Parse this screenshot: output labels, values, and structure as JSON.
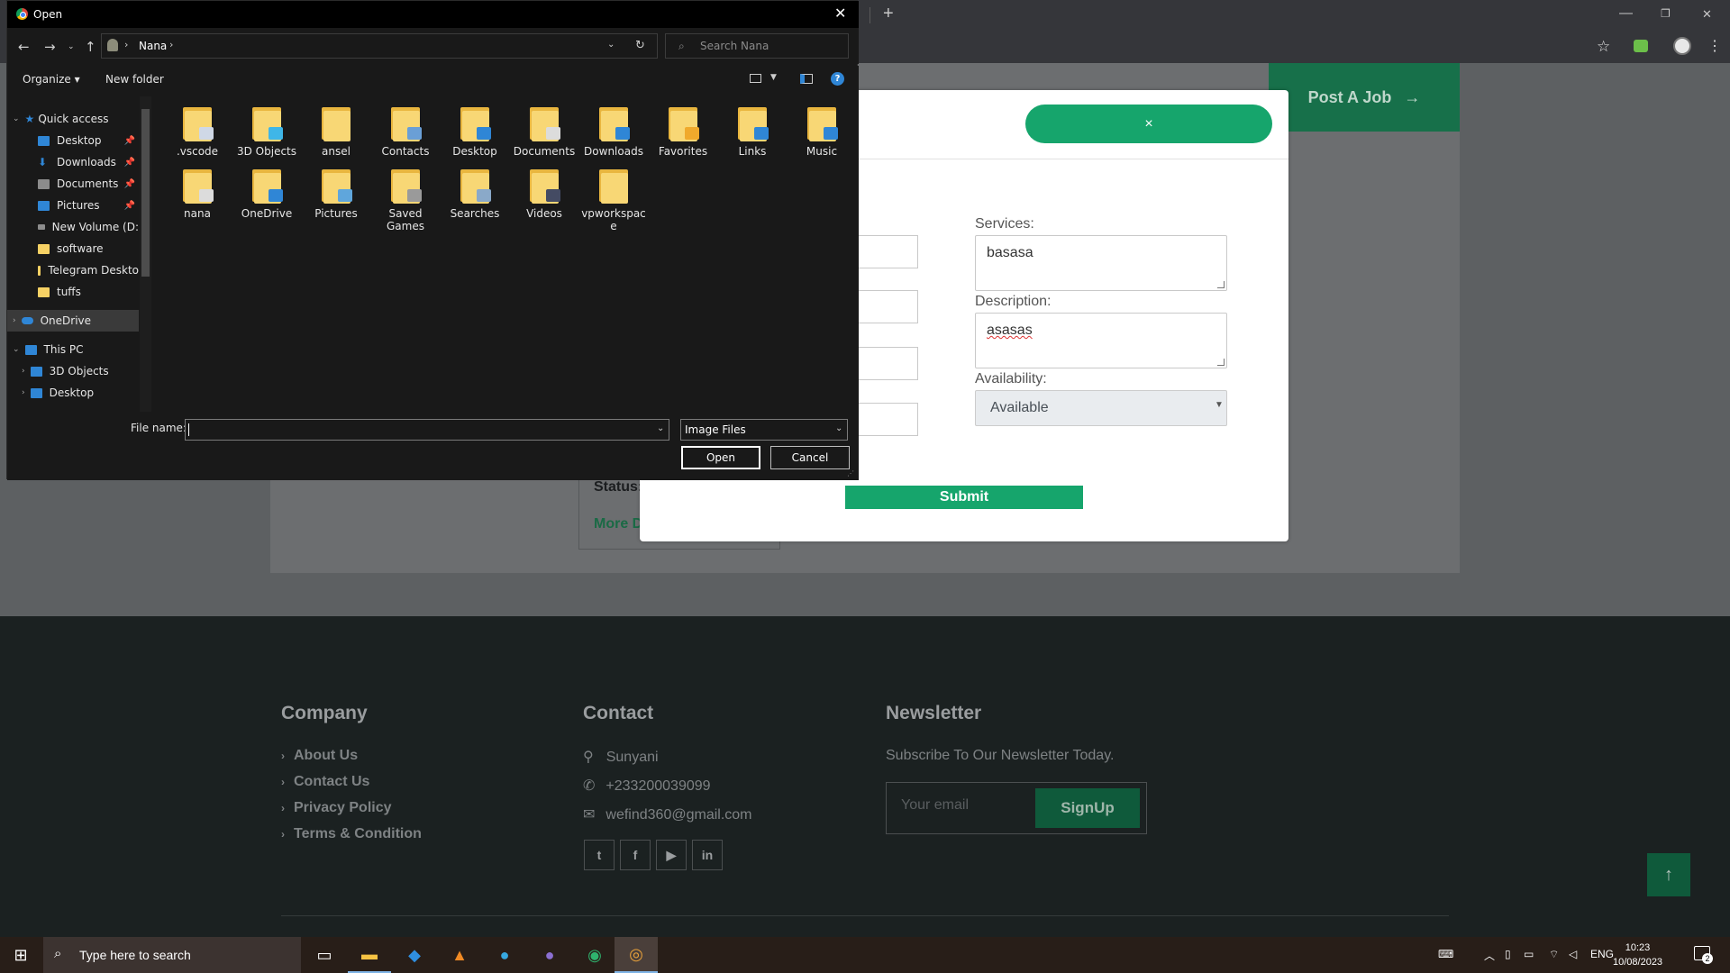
{
  "browser": {
    "new_tab_symbol": "+",
    "minimize": "—",
    "restore": "❐",
    "close": "✕"
  },
  "page": {
    "post_job_label": "Post A Job",
    "post_job_arrow": "→",
    "status_label": "Status:",
    "more_link": "More D"
  },
  "modal": {
    "close_symbol": "×",
    "services_label": "Services:",
    "services_value": "basasa",
    "description_label": "Description:",
    "description_value": "asasas",
    "availability_label": "Availability:",
    "availability_value": "Available",
    "submit_label": "Submit"
  },
  "footer": {
    "company": {
      "heading": "Company",
      "links": [
        "About Us",
        "Contact Us",
        "Privacy Policy",
        "Terms & Condition"
      ]
    },
    "contact": {
      "heading": "Contact",
      "location": "Sunyani",
      "phone": "+233200039099",
      "email": "wefind360@gmail.com",
      "social": [
        "t",
        "f",
        "▶",
        "in"
      ]
    },
    "newsletter": {
      "heading": "Newsletter",
      "text": "Subscribe To Our Newsletter Today.",
      "placeholder": "Your email",
      "button": "SignUp"
    },
    "back_to_top": "↑"
  },
  "dialog": {
    "title": "Open",
    "close": "✕",
    "path": "Nana",
    "search_placeholder": "Search Nana",
    "organize": "Organize ▾",
    "new_folder": "New folder",
    "nav_items": [
      {
        "label": "Quick access",
        "icon": "star-icon"
      },
      {
        "label": "Desktop",
        "icon": "desktop-icon"
      },
      {
        "label": "Downloads",
        "icon": "download-icon"
      },
      {
        "label": "Documents",
        "icon": "document-icon"
      },
      {
        "label": "Pictures",
        "icon": "pictures-icon"
      },
      {
        "label": "New Volume (D:",
        "icon": "drive-icon"
      },
      {
        "label": "software",
        "icon": "folder-icon"
      },
      {
        "label": "Telegram Deskto",
        "icon": "folder-icon"
      },
      {
        "label": "tuffs",
        "icon": "folder-icon"
      },
      {
        "label": "OneDrive",
        "icon": "cloud-icon"
      },
      {
        "label": "This PC",
        "icon": "computer-icon"
      },
      {
        "label": "3D Objects",
        "icon": "cube-icon"
      },
      {
        "label": "Desktop",
        "icon": "desktop-icon"
      }
    ],
    "files_row1": [
      ".vscode",
      "3D Objects",
      "ansel",
      "Contacts",
      "Desktop",
      "Documents",
      "Downloads",
      "Favorites",
      "Links",
      "Music"
    ],
    "files_row2": [
      "nana",
      "OneDrive",
      "Pictures",
      "Saved Games",
      "Searches",
      "Videos",
      "vpworkspace"
    ],
    "file_name_label": "File name:",
    "file_name_value": "",
    "file_type": "Image Files",
    "open_button": "Open",
    "cancel_button": "Cancel"
  },
  "taskbar": {
    "search_placeholder": "Type here to search",
    "language": "ENG",
    "time": "10:23",
    "date": "10/08/2023",
    "notifications": "2"
  },
  "colors": {
    "accent_green": "#16a56c",
    "dark_green": "#0f5a3b",
    "footer_bg": "#1b2121"
  }
}
